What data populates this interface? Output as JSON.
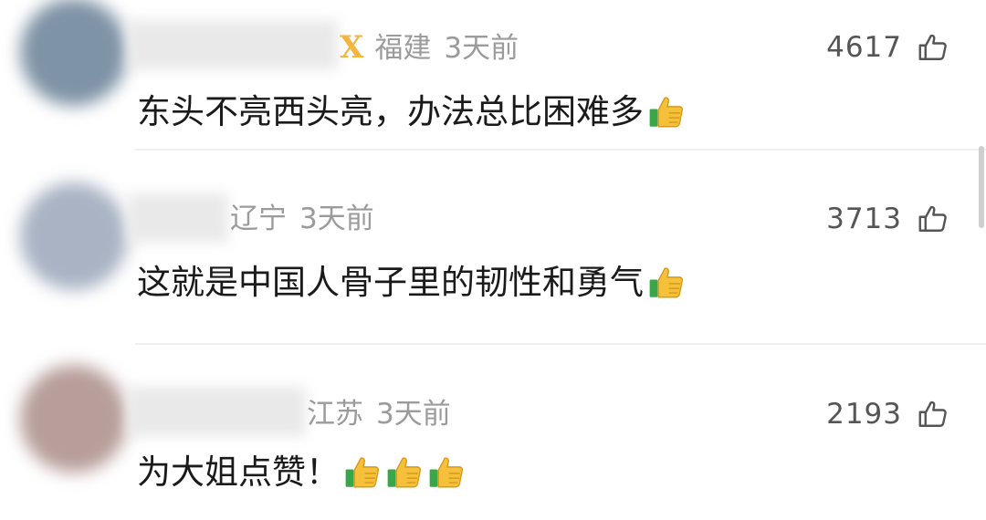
{
  "comments": [
    {
      "location": "福建",
      "time": "3天前",
      "badge": "Ⅹ",
      "likes": "4617",
      "text": "东头不亮西头亮，办法总比困难多",
      "thumbs": 1,
      "avatar_color": "#7f93a6"
    },
    {
      "location": "辽宁",
      "time": "3天前",
      "likes": "3713",
      "text": "这就是中国人骨子里的韧性和勇气",
      "thumbs": 1,
      "avatar_color": "#a9b3c4"
    },
    {
      "location": "江苏",
      "time": "3天前",
      "likes": "2193",
      "text": "为大姐点赞！",
      "thumbs": 3,
      "avatar_color": "#b79e9a"
    }
  ],
  "colors": {
    "meta": "#9b9b9b",
    "text": "#1a1a1a",
    "badge": "#f2b540",
    "thumb_yellow": "#f5c13a",
    "thumb_green": "#3aa64a"
  }
}
